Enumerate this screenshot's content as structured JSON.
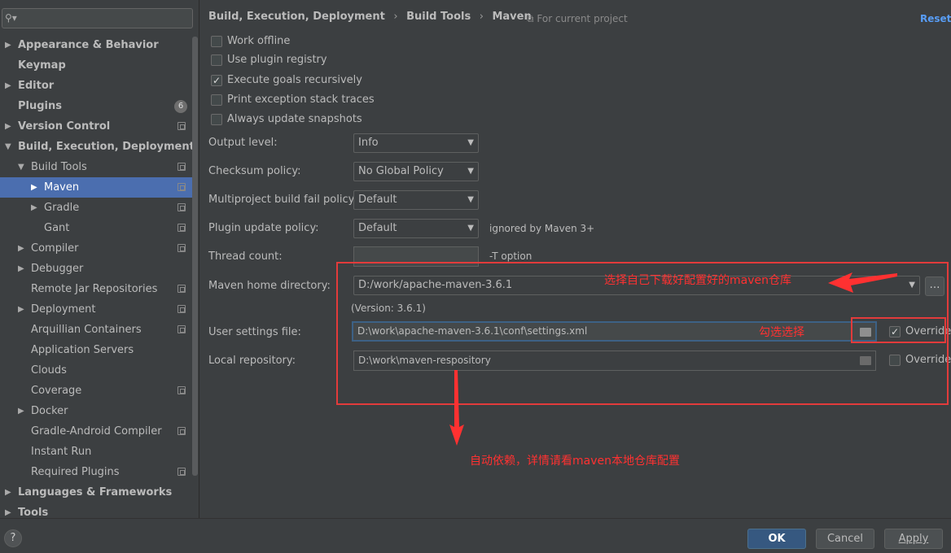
{
  "search": {
    "placeholder": "",
    "icon": "search-icon"
  },
  "sidebar": {
    "items": [
      {
        "label": "Appearance & Behavior",
        "expandable": true,
        "expanded": false,
        "bold": true,
        "level": 0
      },
      {
        "label": "Keymap",
        "expandable": false,
        "bold": true,
        "level": 0
      },
      {
        "label": "Editor",
        "expandable": true,
        "expanded": false,
        "bold": true,
        "level": 0
      },
      {
        "label": "Plugins",
        "expandable": false,
        "bold": true,
        "level": 0,
        "badge": "6"
      },
      {
        "label": "Version Control",
        "expandable": true,
        "expanded": false,
        "bold": true,
        "level": 0,
        "project": true
      },
      {
        "label": "Build, Execution, Deployment",
        "expandable": true,
        "expanded": true,
        "bold": true,
        "level": 0
      },
      {
        "label": "Build Tools",
        "expandable": true,
        "expanded": true,
        "level": 1,
        "project": true
      },
      {
        "label": "Maven",
        "expandable": true,
        "expanded": false,
        "level": 2,
        "project": true,
        "selected": true
      },
      {
        "label": "Gradle",
        "expandable": true,
        "expanded": false,
        "level": 2,
        "project": true
      },
      {
        "label": "Gant",
        "expandable": false,
        "level": 2,
        "project": true
      },
      {
        "label": "Compiler",
        "expandable": true,
        "expanded": false,
        "level": 1,
        "project": true
      },
      {
        "label": "Debugger",
        "expandable": true,
        "expanded": false,
        "level": 1
      },
      {
        "label": "Remote Jar Repositories",
        "expandable": false,
        "level": 1,
        "project": true
      },
      {
        "label": "Deployment",
        "expandable": true,
        "expanded": false,
        "level": 1,
        "project": true
      },
      {
        "label": "Arquillian Containers",
        "expandable": false,
        "level": 1,
        "project": true
      },
      {
        "label": "Application Servers",
        "expandable": false,
        "level": 1
      },
      {
        "label": "Clouds",
        "expandable": false,
        "level": 1
      },
      {
        "label": "Coverage",
        "expandable": false,
        "level": 1,
        "project": true
      },
      {
        "label": "Docker",
        "expandable": true,
        "expanded": false,
        "level": 1
      },
      {
        "label": "Gradle-Android Compiler",
        "expandable": false,
        "level": 1,
        "project": true
      },
      {
        "label": "Instant Run",
        "expandable": false,
        "level": 1
      },
      {
        "label": "Required Plugins",
        "expandable": false,
        "level": 1,
        "project": true
      },
      {
        "label": "Languages & Frameworks",
        "expandable": true,
        "expanded": false,
        "bold": true,
        "level": 0
      },
      {
        "label": "Tools",
        "expandable": true,
        "expanded": false,
        "bold": true,
        "level": 0
      }
    ]
  },
  "header": {
    "breadcrumb": [
      "Build, Execution, Deployment",
      "Build Tools",
      "Maven"
    ],
    "scope": "For current project",
    "reset": "Reset"
  },
  "checkboxes": [
    {
      "label": "Work offline",
      "checked": false
    },
    {
      "label": "Use plugin registry",
      "checked": false
    },
    {
      "label": "Execute goals recursively",
      "checked": true
    },
    {
      "label": "Print exception stack traces",
      "checked": false
    },
    {
      "label": "Always update snapshots",
      "checked": false
    }
  ],
  "form": {
    "output_level": {
      "label": "Output level:",
      "value": "Info"
    },
    "checksum_policy": {
      "label": "Checksum policy:",
      "value": "No Global Policy"
    },
    "multiproject_policy": {
      "label": "Multiproject build fail policy:",
      "value": "Default"
    },
    "plugin_update_policy": {
      "label": "Plugin update policy:",
      "value": "Default",
      "hint": "ignored by Maven 3+"
    },
    "thread_count": {
      "label": "Thread count:",
      "value": "",
      "hint": "-T option"
    },
    "maven_home": {
      "label": "Maven home directory:",
      "value": "D:/work/apache-maven-3.6.1",
      "version": "(Version: 3.6.1)"
    },
    "user_settings": {
      "label": "User settings file:",
      "value": "D:\\work\\apache-maven-3.6.1\\conf\\settings.xml",
      "override_label": "Override",
      "override_checked": true
    },
    "local_repo": {
      "label": "Local repository:",
      "value": "D:\\work\\maven-respository",
      "override_label": "Override",
      "override_checked": false
    }
  },
  "annotations": {
    "maven_home_note": "选择自己下载好配置好的maven仓库",
    "override_note": "勾选选择",
    "local_repo_note": "自动依赖，详情请看maven本地仓库配置",
    "color": "#ff3131"
  },
  "footer": {
    "help": "?",
    "ok": "OK",
    "cancel": "Cancel",
    "apply": "Apply"
  },
  "colors": {
    "selection": "#4b6eaf",
    "link": "#589df6",
    "primary_button": "#365880",
    "annotation": "#e23b3b"
  }
}
